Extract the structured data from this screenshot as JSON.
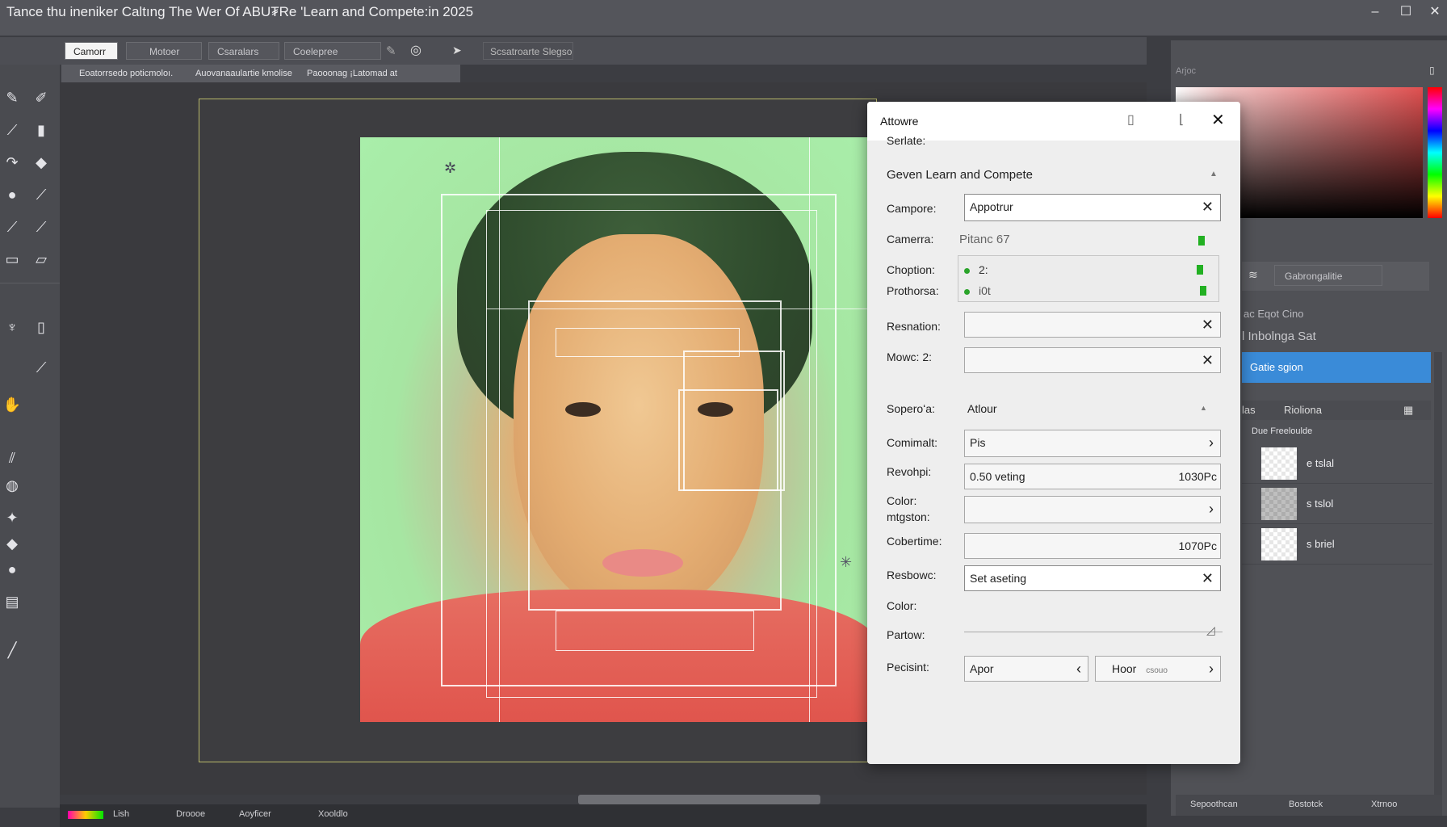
{
  "window": {
    "title": "Tance thu ineniker Caltıng The Wer Of ABU₮Re 'Learn and Compete:in 2025",
    "minimize_icon": "minimize-icon",
    "maximize_icon": "maximize-icon",
    "close_icon": "close-icon"
  },
  "toolbar": {
    "tabs": [
      "Camorr",
      "Motoer",
      "Csaralars",
      "Coelepree"
    ],
    "search_label": "Scsatroarte Slegso"
  },
  "subtoolbar": {
    "items": [
      "Eoatorrsedo poticmoloı.",
      "Auovanaaulartie kmolise",
      "Paooonag ¡Latomad at"
    ]
  },
  "dialog": {
    "title": "Attowre",
    "section_label": "Serlate:",
    "group_title": "Geven Learn and Compete",
    "fields": {
      "campore_label": "Campore:",
      "campore_value": "Appotrur",
      "camerra_label": "Camerra:",
      "camerra_value": "Pitanc 67",
      "choption_label": "Choption:",
      "choption_value": "2:",
      "prothorsa_label": "Prothorsa:",
      "prothorsa_value": "i0t",
      "resnation_label": "Resnation:",
      "mowc_label": "Mowc: 2:",
      "sopero_label": "Soperoʻa:",
      "sopero_value": "Atlour",
      "comimalt_label": "Comimalt:",
      "comimalt_value": "Pis",
      "revohpi_label": "Revohpi:",
      "revohpi_value": "0.50 veting",
      "revohpi_unit": "1030Pc",
      "color_mtgston_label_1": "Color:",
      "color_mtgston_label_2": "mtgston:",
      "cobertime_label": "Cobertime:",
      "cobertime_value": "1070Pc",
      "resbowc_label": "Resbowc:",
      "resbowc_value": "Set aseting",
      "color_label": "Color:",
      "partow_label": "Partow:",
      "pecisint_label": "Pecisint:",
      "pecisint_value": "Apor",
      "hoor_value": "Hoor",
      "hoor_sub": "csouo"
    }
  },
  "right_panel": {
    "header": "Arjoc",
    "button_label": "Gabrongalitie",
    "rows": [
      "ac Eqot Cino",
      "l Inbolnga Sat"
    ],
    "selected_row": "Gatie sgion",
    "tabs": [
      "las",
      "Rioliona"
    ],
    "section": "Due Freeloulde",
    "layers": [
      "e tslal",
      "s tslol",
      "s briel"
    ],
    "bottom": [
      "Sepoothcan",
      "Bostotck",
      "Xtrnoo"
    ]
  },
  "statusbar": {
    "items": [
      "Lish",
      "Droooe",
      "Aoyficer",
      "Xooldlo"
    ]
  },
  "colors": {
    "accent": "#3a8bd8",
    "success": "#22b022",
    "background": "#3c3d42"
  }
}
